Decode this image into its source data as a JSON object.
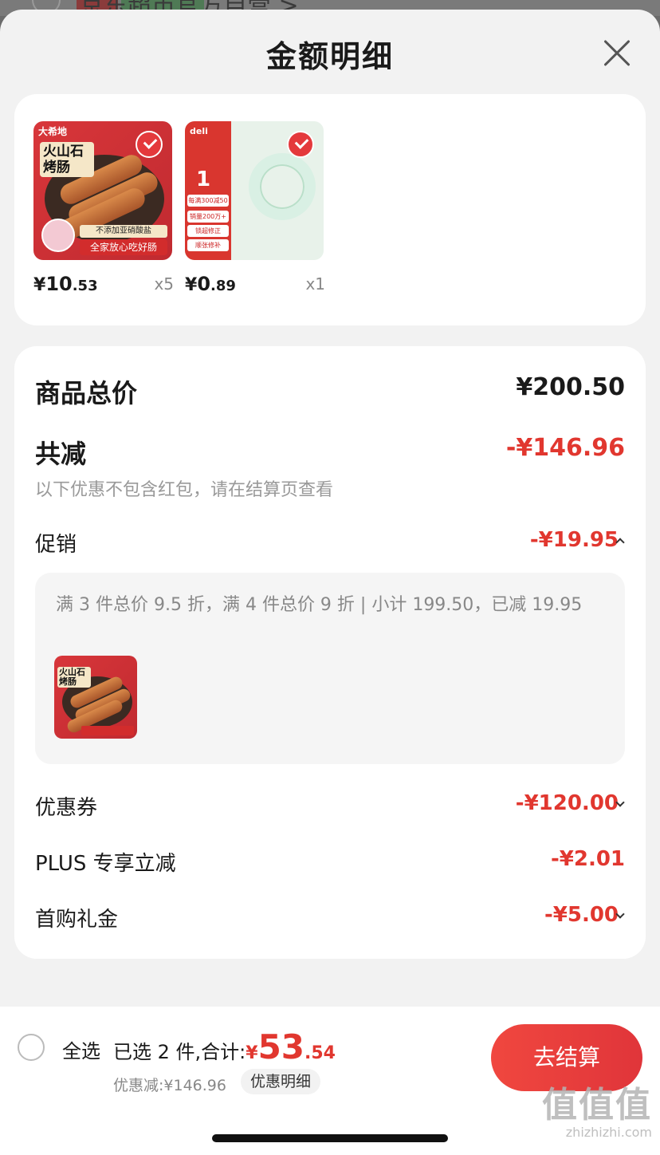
{
  "background": {
    "tag_self": "自营",
    "tag_store": "京东超市",
    "store_name": "京东超市官方自营 >"
  },
  "sheet": {
    "title": "金额明细"
  },
  "products": [
    {
      "name_badge": "火山石烤肠",
      "brand": "大希地",
      "bar_text": "全家放心吃好肠",
      "bar2_text": "不添加亚硝酸盐",
      "price_int": "10",
      "price_dec": ".53",
      "qty": "x5",
      "checked": true
    },
    {
      "brand": "deli",
      "num_text": "1",
      "labels": [
        "每满300减50",
        "销量200万+",
        "锁超修正",
        "顺张修补"
      ],
      "price_int": "0",
      "price_dec": ".89",
      "qty": "x1",
      "checked": true
    }
  ],
  "currency": "¥",
  "detail": {
    "goods_total_label": "商品总价",
    "goods_total_value": "¥200.50",
    "reduction_label": "共减",
    "reduction_value": "-¥146.96",
    "reduction_note": "以下优惠不包含红包，请在结算页查看",
    "promo_label": "促销",
    "promo_value": "-¥19.95",
    "promo_desc": "满 3 件总价 9.5 折，满 4 件总价 9 折 | 小计 199.50，已减 19.95",
    "mini_name": "火山石烤肠",
    "coupon_label": "优惠券",
    "coupon_value": "-¥120.00",
    "plus_label": "PLUS 专享立减",
    "plus_value": "-¥2.01",
    "first_label": "首购礼金",
    "first_value": "-¥5.00"
  },
  "bottom": {
    "select_all": "全选",
    "summary_prefix": "已选 2 件,合计:",
    "total_yen": "¥",
    "total_int": "53",
    "total_dec": ".54",
    "saving": "优惠减:¥146.96",
    "detail_chip": "优惠明细",
    "checkout": "去结算"
  },
  "watermark": {
    "big": "值值值",
    "small": "zhizhizhi.com"
  },
  "colors": {
    "accent_red": "#e1372f",
    "checkout_gradient_start": "#f0473f",
    "checkout_gradient_end": "#e0353a",
    "sheet_bg": "#f2f2f2"
  }
}
